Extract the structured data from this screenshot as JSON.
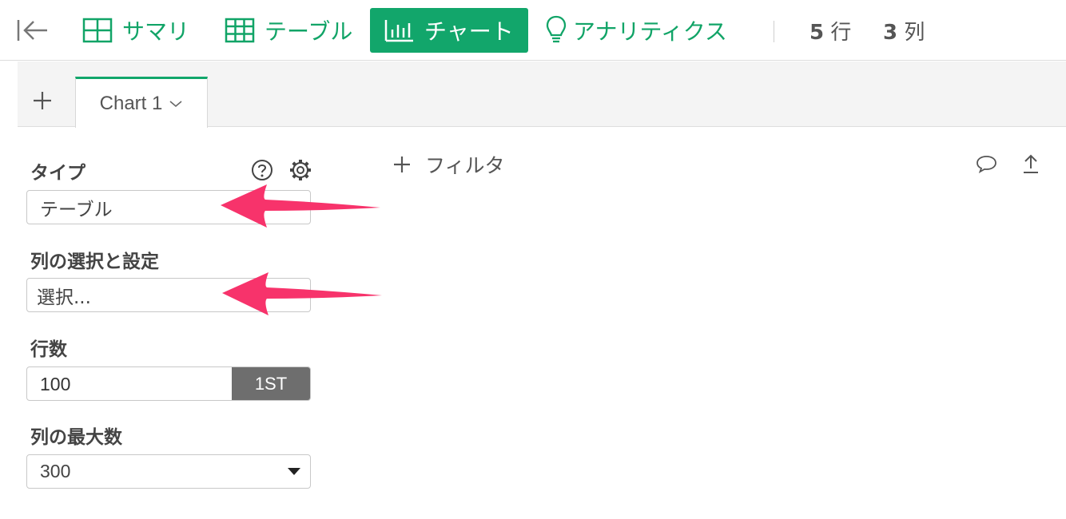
{
  "toolbar": {
    "nav": [
      {
        "label": "サマリ",
        "icon": "grid-icon"
      },
      {
        "label": "テーブル",
        "icon": "table-icon"
      },
      {
        "label": "チャート",
        "icon": "bar-chart-icon",
        "active": true
      },
      {
        "label": "アナリティクス",
        "icon": "lightbulb-icon"
      }
    ],
    "rows_count": "5",
    "rows_unit": "行",
    "cols_count": "3",
    "cols_unit": "列"
  },
  "tabs": {
    "chart_tab_label": "Chart 1"
  },
  "panel": {
    "type_label": "タイプ",
    "type_value": "テーブル",
    "columns_label": "列の選択と設定",
    "columns_placeholder": "選択...",
    "rows_label": "行数",
    "rows_value": "100",
    "rows_button": "1ST",
    "max_cols_label": "列の最大数",
    "max_cols_value": "300"
  },
  "main": {
    "filter_label": "フィルタ"
  },
  "colors": {
    "accent": "#12a66b",
    "annotation_arrow": "#f7336b"
  }
}
